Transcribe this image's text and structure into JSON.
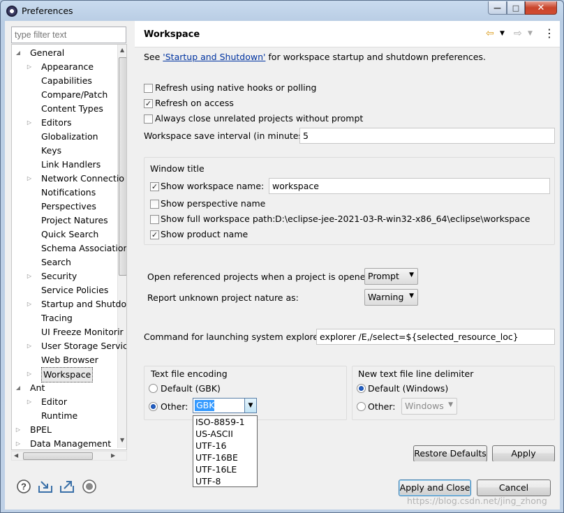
{
  "window": {
    "title": "Preferences"
  },
  "window_controls": {
    "minimize": "—",
    "maximize": "□",
    "close": "✕"
  },
  "filter": {
    "placeholder": "type filter text"
  },
  "tree": {
    "items": [
      {
        "label": "General",
        "expanded": true
      },
      {
        "label": "Appearance",
        "has_children": true
      },
      {
        "label": "Capabilities"
      },
      {
        "label": "Compare/Patch"
      },
      {
        "label": "Content Types"
      },
      {
        "label": "Editors",
        "has_children": true
      },
      {
        "label": "Globalization"
      },
      {
        "label": "Keys"
      },
      {
        "label": "Link Handlers"
      },
      {
        "label": "Network Connectio",
        "has_children": true
      },
      {
        "label": "Notifications"
      },
      {
        "label": "Perspectives"
      },
      {
        "label": "Project Natures"
      },
      {
        "label": "Quick Search"
      },
      {
        "label": "Schema Association"
      },
      {
        "label": "Search"
      },
      {
        "label": "Security",
        "has_children": true
      },
      {
        "label": "Service Policies"
      },
      {
        "label": "Startup and Shutdo",
        "has_children": true
      },
      {
        "label": "Tracing"
      },
      {
        "label": "UI Freeze Monitorir"
      },
      {
        "label": "User Storage Servic",
        "has_children": true
      },
      {
        "label": "Web Browser"
      },
      {
        "label": "Workspace",
        "has_children": true,
        "selected": true
      },
      {
        "label": "Ant",
        "expanded": true
      },
      {
        "label": "Editor",
        "has_children": true
      },
      {
        "label": "Runtime"
      },
      {
        "label": "BPEL",
        "has_children": true
      },
      {
        "label": "Data Management",
        "has_children": true
      }
    ]
  },
  "page": {
    "title": "Workspace",
    "intro_prefix": "See ",
    "intro_link": "'Startup and Shutdown'",
    "intro_suffix": " for workspace startup and shutdown preferences.",
    "options": [
      {
        "label": "Refresh using native hooks or polling",
        "checked": false
      },
      {
        "label": "Refresh on access",
        "checked": true
      },
      {
        "label": "Always close unrelated projects without prompt",
        "checked": false
      }
    ],
    "save_interval_label": "Workspace save interval (in minutes):",
    "save_interval_value": "5",
    "window_title_group": "Window title",
    "show_workspace_name_label": "Show workspace name:",
    "workspace_name_value": "workspace",
    "show_perspective_label": "Show perspective name",
    "show_full_path_label": "Show full workspace path:",
    "full_path_value": "D:\\eclipse-jee-2021-03-R-win32-x86_64\\eclipse\\workspace",
    "show_product_label": "Show product name",
    "open_ref_label": "Open referenced projects when a project is opened:",
    "open_ref_value": "Prompt",
    "report_nature_label": "Report unknown project nature as:",
    "report_nature_value": "Warning",
    "cmd_label": "Command for launching system explorer:",
    "cmd_value": "explorer /E,/select=${selected_resource_loc}",
    "encoding_group": "Text file encoding",
    "encoding_default_label": "Default (GBK)",
    "encoding_other_label": "Other:",
    "encoding_value": "GBK",
    "encoding_options": [
      "ISO-8859-1",
      "US-ASCII",
      "UTF-16",
      "UTF-16BE",
      "UTF-16LE",
      "UTF-8"
    ],
    "delimiter_group": "New text file line delimiter",
    "delimiter_default_label": "Default (Windows)",
    "delimiter_other_label": "Other:",
    "delimiter_value": "Windows",
    "restore_defaults": "Restore Defaults",
    "apply": "Apply"
  },
  "footer": {
    "apply_close": "Apply and Close",
    "cancel": "Cancel",
    "icons": [
      "help-icon",
      "import-icon",
      "export-icon",
      "oomph-record-icon"
    ]
  },
  "watermark": "https://blog.csdn.net/jing_zhong"
}
